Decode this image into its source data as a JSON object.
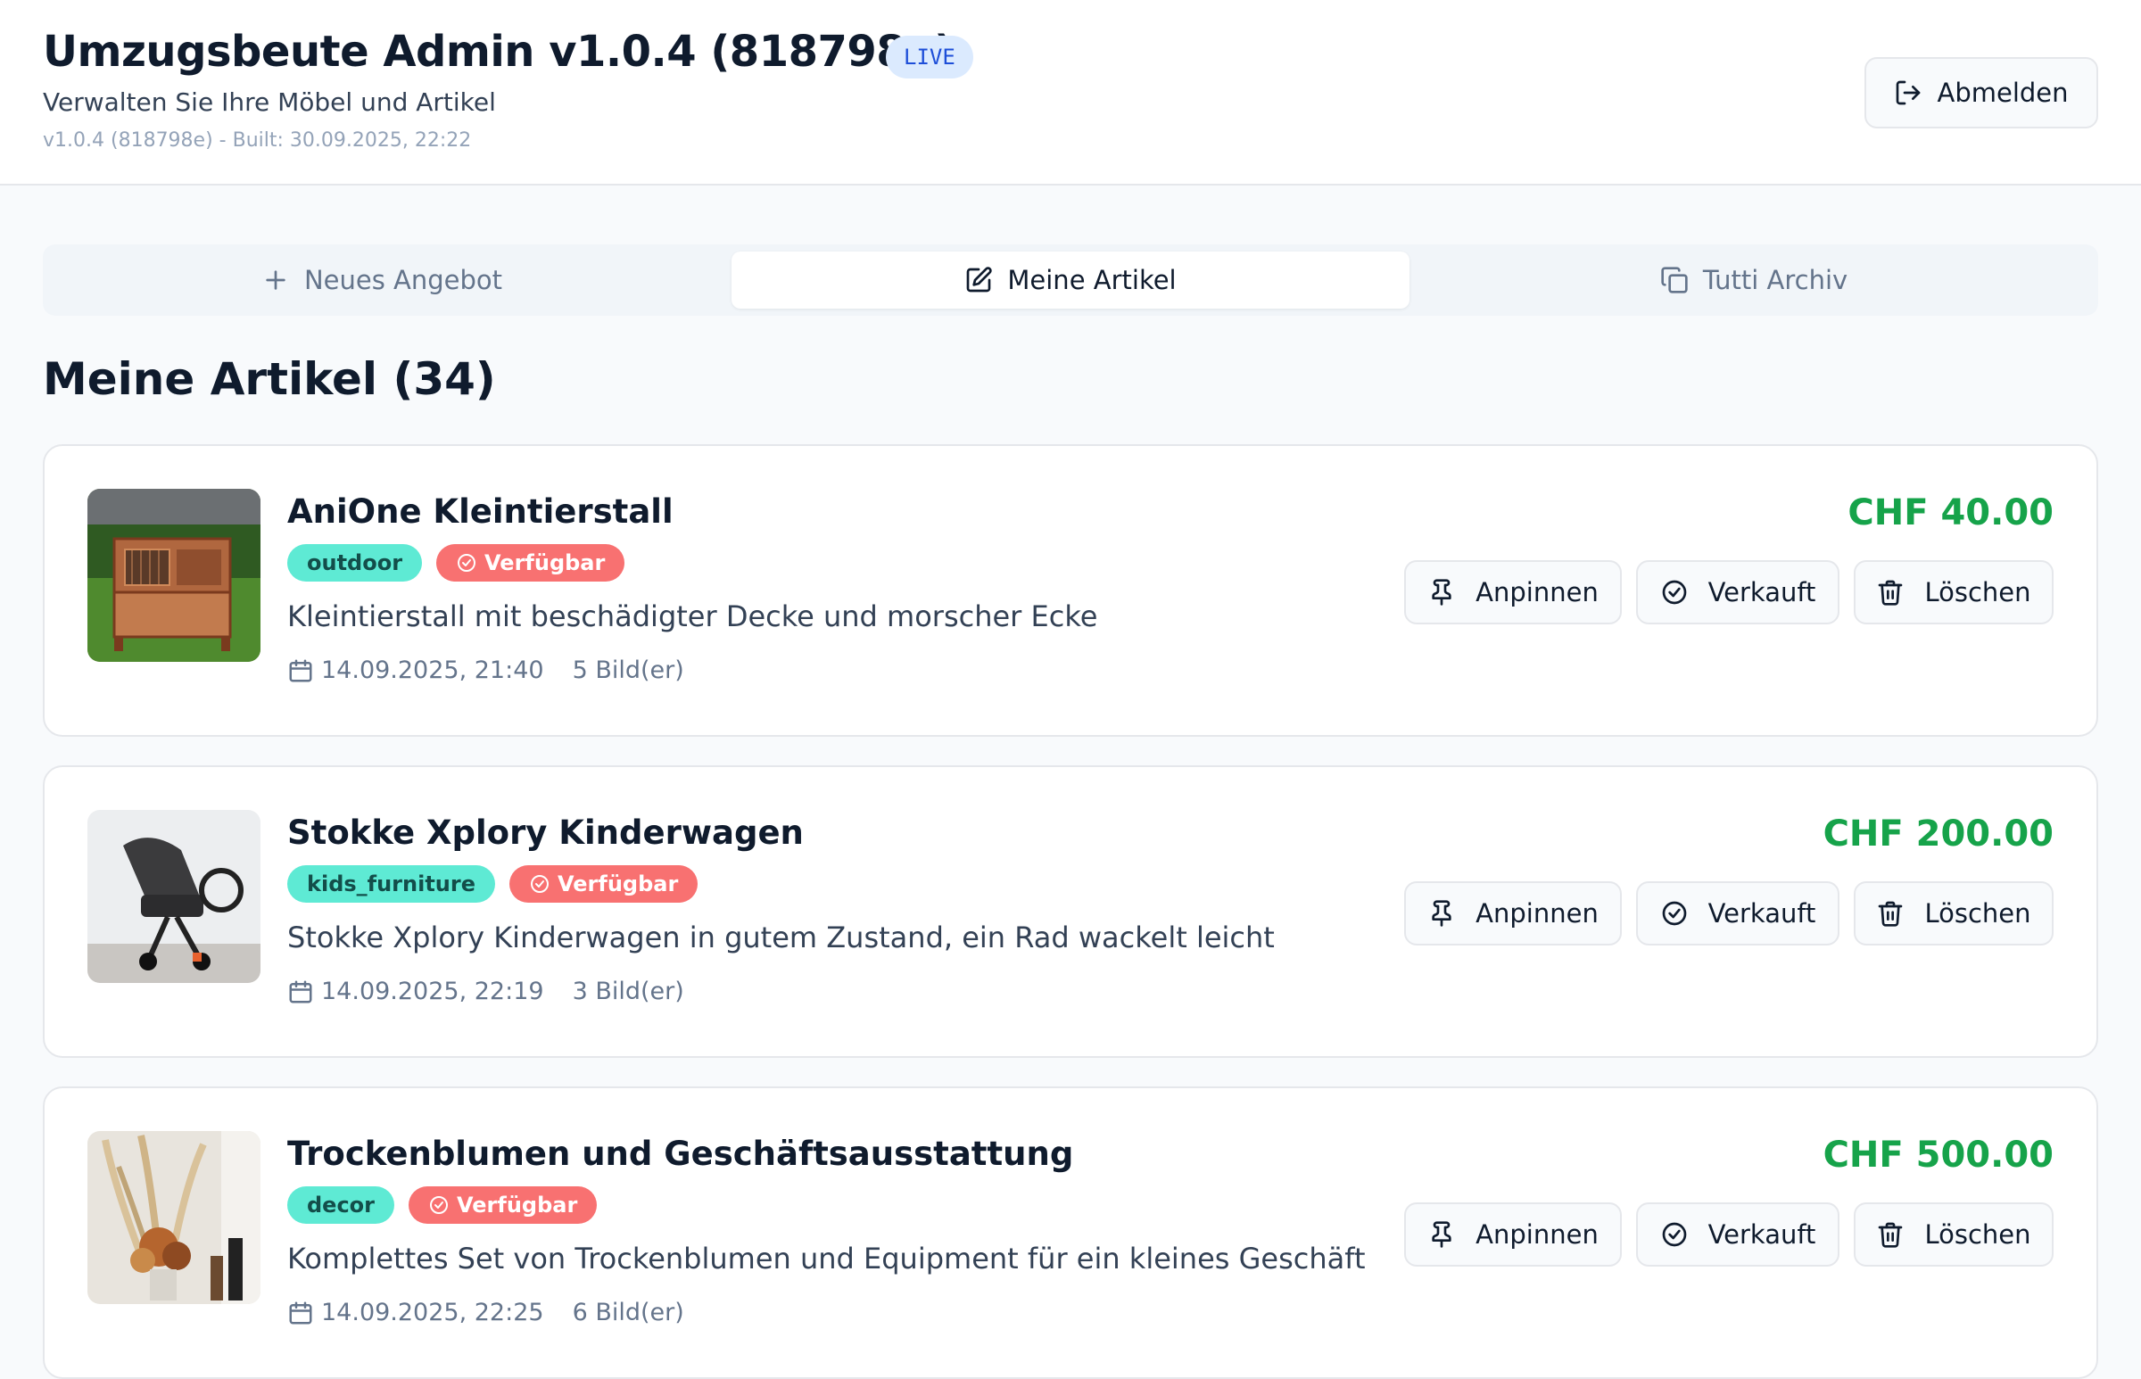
{
  "header": {
    "title": "Umzugsbeute Admin v1.0.4 (818798e)",
    "live_badge": "LIVE",
    "subtitle": "Verwalten Sie Ihre Möbel und Artikel",
    "build_info": "v1.0.4 (818798e) - Built: 30.09.2025, 22:22",
    "logout_label": "Abmelden",
    "logout_icon": "logout-icon"
  },
  "tabs": [
    {
      "label": "Neues Angebot",
      "icon": "plus-icon",
      "active": false
    },
    {
      "label": "Meine Artikel",
      "icon": "edit-icon",
      "active": true
    },
    {
      "label": "Tutti Archiv",
      "icon": "copy-icon",
      "active": false
    }
  ],
  "section": {
    "title": "Meine Artikel (34)"
  },
  "actions": {
    "pin_label": "Anpinnen",
    "sold_label": "Verkauft",
    "delete_label": "Löschen"
  },
  "items": [
    {
      "title": "AniOne Kleintierstall",
      "category": "outdoor",
      "status": "Verfügbar",
      "description": "Kleintierstall mit beschädigter Decke und morscher Ecke",
      "date": "14.09.2025, 21:40",
      "images": "5 Bild(er)",
      "price": "CHF 40.00"
    },
    {
      "title": "Stokke Xplory Kinderwagen",
      "category": "kids_furniture",
      "status": "Verfügbar",
      "description": "Stokke Xplory Kinderwagen in gutem Zustand, ein Rad wackelt leicht",
      "date": "14.09.2025, 22:19",
      "images": "3 Bild(er)",
      "price": "CHF 200.00"
    },
    {
      "title": "Trockenblumen und Geschäftsausstattung",
      "category": "decor",
      "status": "Verfügbar",
      "description": "Komplettes Set von Trockenblumen und Equipment für ein kleines Geschäft",
      "date": "14.09.2025, 22:25",
      "images": "6 Bild(er)",
      "price": "CHF 500.00"
    }
  ],
  "colors": {
    "price": "#16a34a",
    "status_badge": "#f87171",
    "category_badge": "#5eead4",
    "live_badge": "#dbeafe"
  }
}
